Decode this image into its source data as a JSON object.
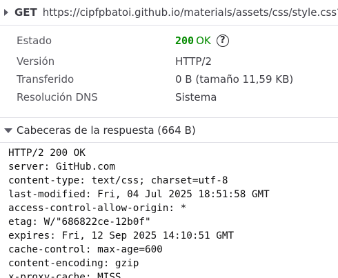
{
  "request": {
    "method": "GET",
    "url": "https://cipfpbatoi.github.io/materials/assets/css/style.css?"
  },
  "summary": [
    {
      "label": "Estado",
      "status_code": "200",
      "status_text": "OK"
    },
    {
      "label": "Versión",
      "value": "HTTP/2"
    },
    {
      "label": "Transferido",
      "value": "0 B (tamaño 11,59 KB)"
    },
    {
      "label": "Resolución DNS",
      "value": "Sistema"
    }
  ],
  "help_icon_glyph": "?",
  "response_headers": {
    "title": "Cabeceras de la respuesta (664 B)",
    "lines": [
      "HTTP/2 200 OK",
      "server: GitHub.com",
      "content-type: text/css; charset=utf-8",
      "last-modified: Fri, 04 Jul 2025 18:51:58 GMT",
      "access-control-allow-origin: *",
      "etag: W/\"686822ce-12b0f\"",
      "expires: Fri, 12 Sep 2025 14:10:51 GMT",
      "cache-control: max-age=600",
      "content-encoding: gzip",
      "x-proxy-cache: MISS"
    ]
  },
  "colors": {
    "status_ok": "#058b00",
    "divider": "#e0e0e6"
  }
}
